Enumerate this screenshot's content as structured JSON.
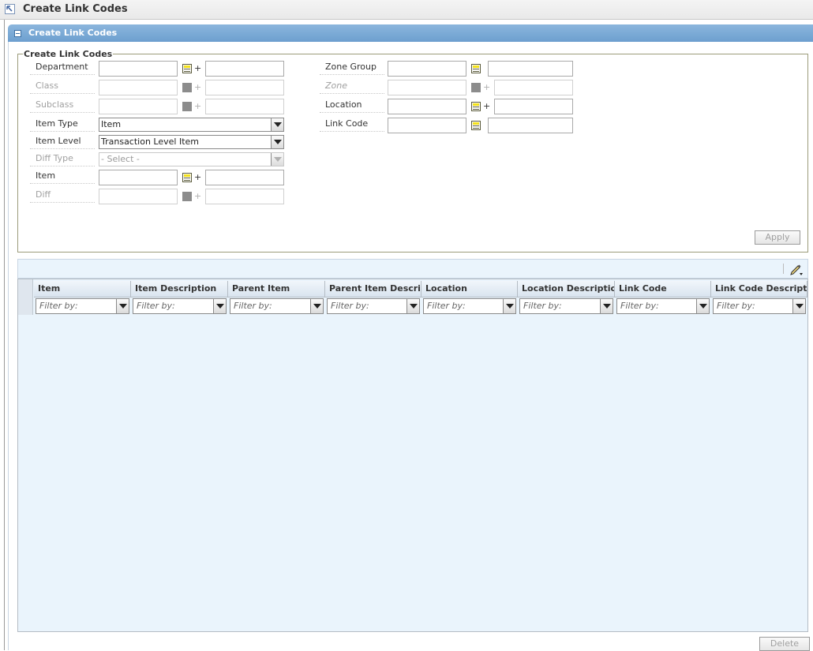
{
  "window": {
    "title": "Create Link Codes"
  },
  "panel": {
    "title": "Create Link Codes"
  },
  "form": {
    "legend": "Create Link Codes",
    "department_label": "Department",
    "class_label": "Class",
    "subclass_label": "Subclass",
    "item_type_label": "Item Type",
    "item_type_value": "Item",
    "item_level_label": "Item Level",
    "item_level_value": "Transaction Level Item",
    "diff_type_label": "Diff Type",
    "diff_type_value": "- Select -",
    "item_label": "Item",
    "diff_label": "Diff",
    "zone_group_label": "Zone Group",
    "zone_label": "Zone",
    "location_label": "Location",
    "link_code_label": "Link Code",
    "plus": "+",
    "apply_label": "Apply"
  },
  "table": {
    "columns": [
      "Item",
      "Item Description",
      "Parent Item",
      "Parent Item Description",
      "Location",
      "Location Description",
      "Link Code",
      "Link Code Description"
    ],
    "filter_placeholder": "Filter by:"
  },
  "footer": {
    "delete_label": "Delete"
  },
  "icons": {
    "back": "back-arrow-icon",
    "lov": "list-of-values-icon",
    "edit": "pencil-edit-icon"
  },
  "colors": {
    "panel_header": "#7aaad6",
    "grid_background": "#eaf4fc",
    "lov_accent": "#f4e21a"
  }
}
